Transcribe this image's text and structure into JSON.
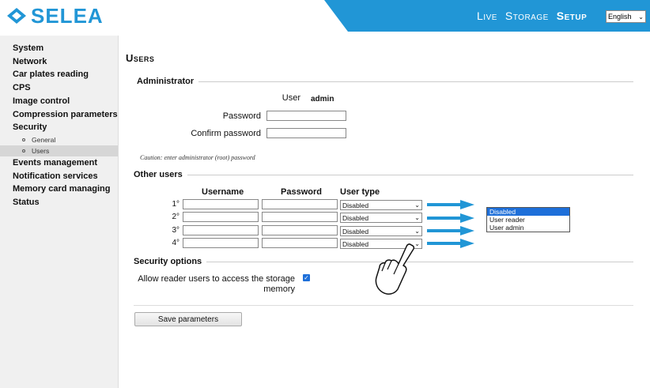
{
  "header": {
    "logo_text": "SELEA",
    "nav": [
      "Live",
      "Storage",
      "Setup"
    ],
    "active_nav": "Setup",
    "language": "English",
    "brand_color": "#2196d6"
  },
  "sidebar": {
    "items": [
      {
        "label": "System"
      },
      {
        "label": "Network"
      },
      {
        "label": "Car plates reading"
      },
      {
        "label": "CPS"
      },
      {
        "label": "Image control"
      },
      {
        "label": "Compression parameters"
      },
      {
        "label": "Security"
      },
      {
        "label": "General",
        "sub": true
      },
      {
        "label": "Users",
        "sub": true,
        "active": true
      },
      {
        "label": "Events management"
      },
      {
        "label": "Notification services"
      },
      {
        "label": "Memory card managing"
      },
      {
        "label": "Status"
      }
    ]
  },
  "main": {
    "title": "Users",
    "administrator": {
      "section_label": "Administrator",
      "user_label": "User",
      "user_value": "admin",
      "password_label": "Password",
      "confirm_label": "Confirm password",
      "caution": "Caution: enter administrator (root) password"
    },
    "other_users": {
      "section_label": "Other users",
      "columns": [
        "Username",
        "Password",
        "User type"
      ],
      "rows": [
        {
          "num": "1°",
          "type": "Disabled"
        },
        {
          "num": "2°",
          "type": "Disabled"
        },
        {
          "num": "3°",
          "type": "Disabled"
        },
        {
          "num": "4°",
          "type": "Disabled"
        }
      ],
      "dropdown_options": [
        "Disabled",
        "User reader",
        "User admin"
      ],
      "dropdown_selected": "Disabled"
    },
    "security_options": {
      "section_label": "Security options",
      "reader_access_label_1": "Allow reader users to access the storage",
      "reader_access_label_2": "memory",
      "reader_access_checked": true
    },
    "save_label": "Save parameters"
  }
}
